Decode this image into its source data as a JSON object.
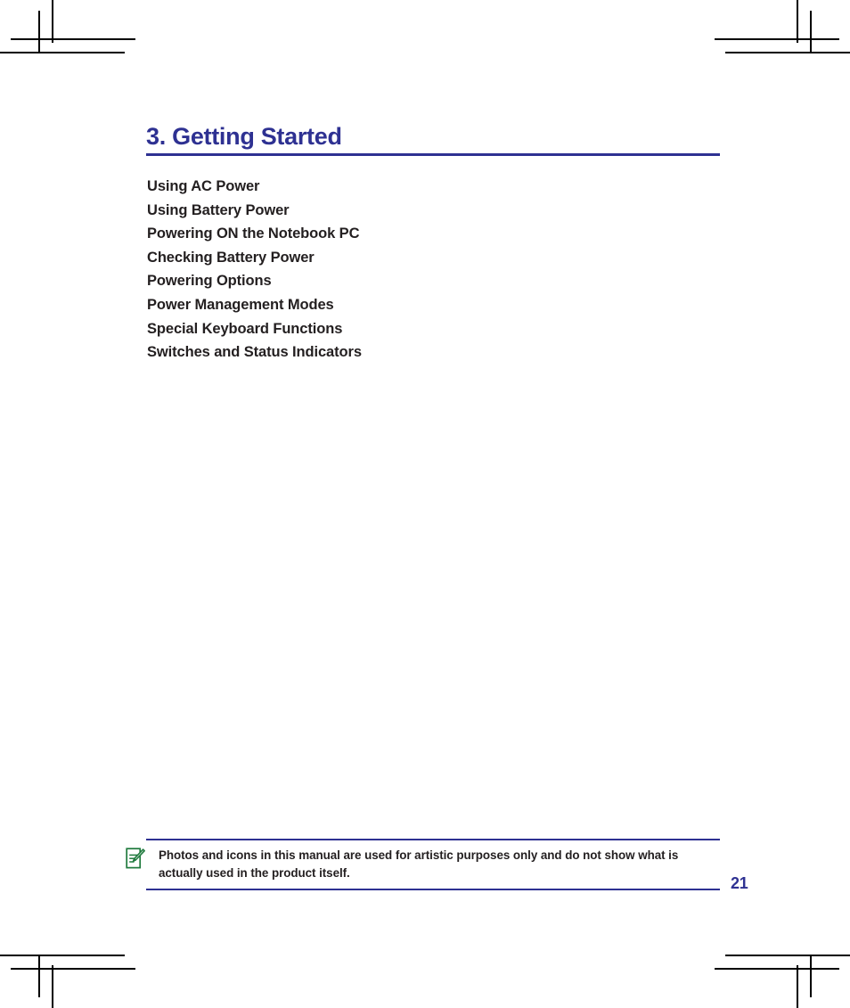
{
  "document": {
    "chapter_title": "3. Getting Started",
    "page_number": "21"
  },
  "toc": {
    "items": [
      {
        "label": "Using AC Power"
      },
      {
        "label": "Using Battery Power"
      },
      {
        "label": "Powering ON the Notebook PC"
      },
      {
        "label": "Checking Battery Power"
      },
      {
        "label": "Powering Options"
      },
      {
        "label": "Power Management Modes"
      },
      {
        "label": "Special Keyboard Functions"
      },
      {
        "label": "Switches and Status Indicators"
      }
    ]
  },
  "note": {
    "icon": "note-pencil-icon",
    "line1": "Photos and icons in this manual are used for artistic purposes only and do not",
    "line2": "show what is actually used in the product itself."
  },
  "colors": {
    "accent_navy": "#2E3192",
    "body_text": "#231F20",
    "note_icon_green": "#1F7A3D",
    "crop_mark": "#000000"
  }
}
